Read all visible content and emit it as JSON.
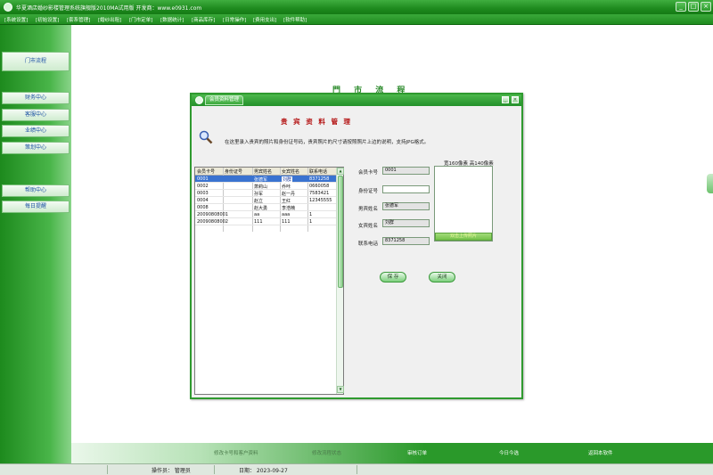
{
  "window": {
    "title": "华夏酒店婚纱影楼管理系统旗舰版2010MA试用版    开发商：www.e0931.com",
    "min_label": "_",
    "max_label": "□",
    "close_label": "×"
  },
  "menu": [
    "[系统设置]",
    "[初始设置]",
    "[套系管理]",
    "[婚纱出租]",
    "[门市定单]",
    "[数据统计]",
    "[商品库存]",
    "[日常操作]",
    "[费用支出]",
    "[软件帮助]"
  ],
  "sidebar": {
    "top": "门市流程",
    "group1": [
      "财务中心",
      "客服中心",
      "业绩中心",
      "策划中心"
    ],
    "group2": [
      "帮助中心",
      "每日提醒"
    ]
  },
  "main": {
    "big_title": "門 市 流 程"
  },
  "shortcuts": [
    "修改卡号和客户资料",
    "修改流程状态",
    "审核订单",
    "今日今选",
    "返回本软件"
  ],
  "status": {
    "operator": "操作员： 管理员",
    "date": "日期： 2023-09-27"
  },
  "dialog": {
    "tab_label": "会员资料管理",
    "heading": "贵 宾 资 料 管 理",
    "note": "在这里录入贵宾的照片和身份证号码，贵宾照片的尺寸请按照照片上边的说明，支持JPG格式。",
    "table": {
      "columns": [
        "会员卡号",
        "身份证号",
        "男宾姓名",
        "女宾姓名",
        "联系电话"
      ],
      "rows": [
        [
          "0001",
          "",
          "张德军",
          "刘群",
          "8371258"
        ],
        [
          "0002",
          "",
          "萧莉山",
          "乔咔",
          "0660058"
        ],
        [
          "0003",
          "",
          "孙军",
          "赵一丹",
          "7583421"
        ],
        [
          "0004",
          "",
          "赵立",
          "王红",
          "12345555"
        ],
        [
          "0008",
          "",
          "赵大勇",
          "李浩楠",
          ""
        ],
        [
          "20090808001",
          "",
          "aa",
          "aaa",
          "1"
        ],
        [
          "20090808002",
          "",
          "111",
          "111",
          "1"
        ]
      ],
      "selected_row": 0
    },
    "form": {
      "card_label": "会员卡号",
      "card_value": "0001",
      "id_label": "身份证号",
      "id_value": "",
      "male_label": "男宾姓名",
      "male_value": "张德军",
      "female_label": "女宾姓名",
      "female_value": "刘群",
      "phone_label": "联系电话",
      "phone_value": "8371258"
    },
    "photo_caption": "宽160像素  高140像素",
    "photo_button": "双击上传照片",
    "save_label": "保 存",
    "close_label": "关闭"
  },
  "colors": {
    "brand_green": "#1e8a1e",
    "heading_red": "#b31010",
    "selection_blue": "#3a73d0"
  }
}
